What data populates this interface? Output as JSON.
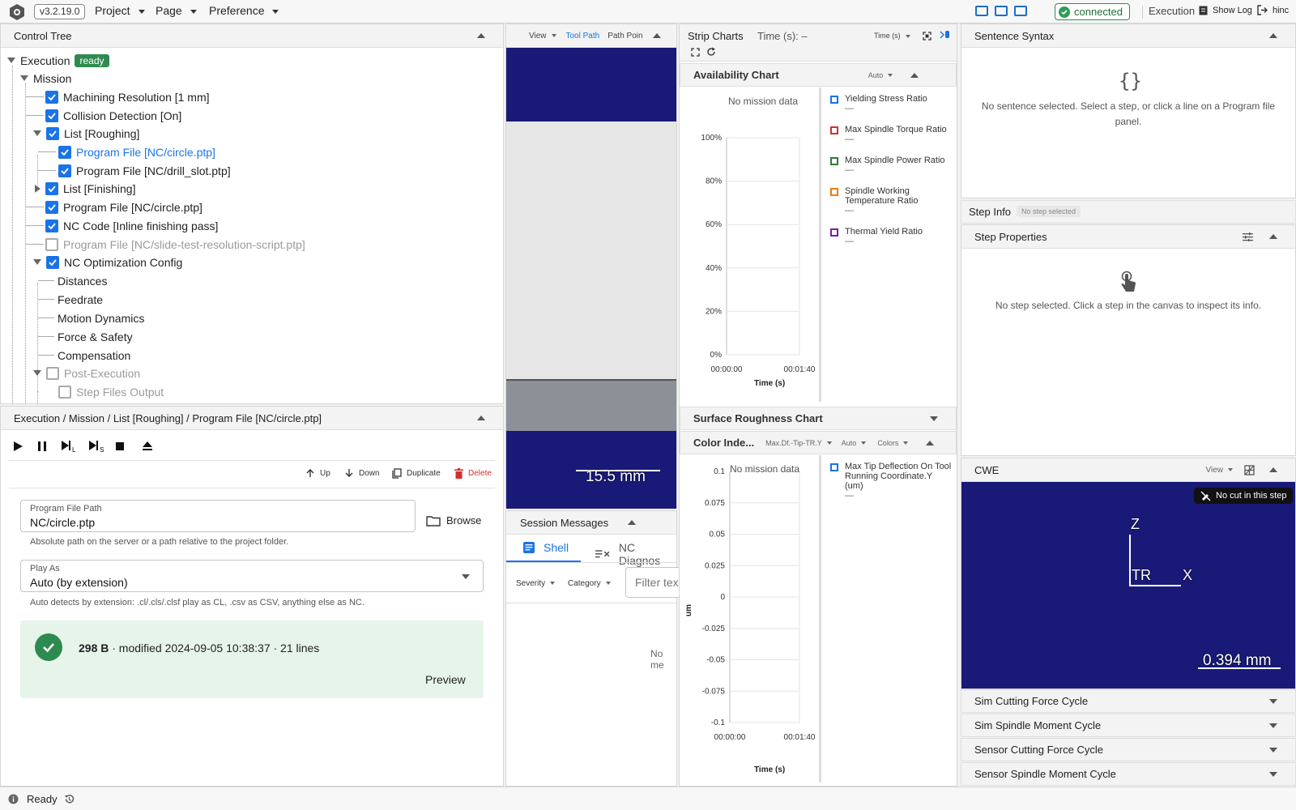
{
  "topbar": {
    "version": "v3.2.19.0",
    "menus": [
      "Project",
      "Page",
      "Preference"
    ],
    "connection": "connected",
    "mode": "Execution",
    "show_log": "Show Log",
    "user": "hinc"
  },
  "control_tree": {
    "title": "Control Tree",
    "execution_label": "Execution",
    "execution_badge": "ready",
    "mission_label": "Mission",
    "items": [
      "Machining Resolution [1 mm]",
      "Collision Detection [On]",
      "List [Roughing]",
      "Program File [NC/circle.ptp]",
      "Program File [NC/drill_slot.ptp]",
      "List [Finishing]",
      "Program File [NC/circle.ptp]",
      "NC Code [Inline finishing pass]",
      "Program File [NC/slide-test-resolution-script.ptp]",
      "NC Optimization Config",
      "Distances",
      "Feedrate",
      "Motion Dynamics",
      "Force & Safety",
      "Compensation",
      "Post-Execution",
      "Step Files Output"
    ]
  },
  "detail": {
    "breadcrumb": "Execution / Mission / List [Roughing] / Program File [NC/circle.ptp]",
    "actions": {
      "up": "Up",
      "down": "Down",
      "duplicate": "Duplicate",
      "delete": "Delete"
    },
    "path_label": "Program File Path",
    "path_value": "NC/circle.ptp",
    "browse": "Browse",
    "path_helper": "Absolute path on the server or a path relative to the project folder.",
    "play_as_label": "Play As",
    "play_as_value": "Auto (by extension)",
    "play_as_helper": "Auto detects by extension: .cl/.cls/.clsf play as CL, .csv as CSV, anything else as NC.",
    "file_size": "298 B",
    "file_meta": "· modified 2024-09-05 10:38:37 · 21 lines",
    "preview": "Preview"
  },
  "viewport": {
    "view": "View",
    "tool_path": "Tool Path",
    "path_point": "Path Poin",
    "scale": "15.5 mm"
  },
  "session": {
    "title": "Session Messages",
    "tab_shell": "Shell",
    "tab_diag": "NC Diagnos",
    "severity": "Severity",
    "category": "Category",
    "filter_placeholder": "Filter tex",
    "empty": "No me"
  },
  "strip": {
    "title": "Strip Charts",
    "time_label": "Time (s): –",
    "time_select": "Time (s)"
  },
  "availability": {
    "title": "Availability Chart",
    "auto": "Auto",
    "no_data": "No mission data",
    "xlabel": "Time (s)"
  },
  "surface": {
    "title": "Surface Roughness Chart"
  },
  "color_index": {
    "title": "Color Inde...",
    "metric": "Max.Df.-Tip-TR.Y",
    "auto": "Auto",
    "colors": "Colors",
    "no_data": "No mission data",
    "ylabel": "um",
    "xlabel": "Time (s)"
  },
  "chart_data": [
    {
      "type": "line",
      "title": "Availability Chart",
      "xlabel": "Time (s)",
      "ylabel": "",
      "x_ticks": [
        "00:00:00",
        "00:01:40"
      ],
      "y_ticks": [
        "100%",
        "80%",
        "60%",
        "40%",
        "20%",
        "0%"
      ],
      "ylim": [
        0,
        100
      ],
      "series": [
        {
          "name": "Yielding Stress Ratio",
          "value": "—",
          "color": "#1a73e8",
          "values": []
        },
        {
          "name": "Max Spindle Torque Ratio",
          "value": "—",
          "color": "#d32f2f",
          "values": []
        },
        {
          "name": "Max Spindle Power Ratio",
          "value": "—",
          "color": "#2e7d32",
          "values": []
        },
        {
          "name": "Spindle Working Temperature Ratio",
          "value": "—",
          "color": "#f57c00",
          "values": []
        },
        {
          "name": "Thermal Yield Ratio",
          "value": "—",
          "color": "#7b1fa2",
          "values": []
        }
      ]
    },
    {
      "type": "line",
      "title": "Color Inde...",
      "xlabel": "Time (s)",
      "ylabel": "um",
      "x_ticks": [
        "00:00:00",
        "00:01:40"
      ],
      "y_ticks": [
        "0.1",
        "0.075",
        "0.05",
        "0.025",
        "0",
        "-0.025",
        "-0.05",
        "-0.075",
        "-0.1"
      ],
      "ylim": [
        -0.1,
        0.1
      ],
      "series": [
        {
          "name": "Max Tip Deflection On Tool Running Coordinate.Y (um)",
          "value": "—",
          "color": "#1a73e8",
          "values": []
        }
      ]
    }
  ],
  "sentence": {
    "title": "Sentence Syntax",
    "empty": "No sentence selected. Select a step, or click a line on a Program file panel."
  },
  "step_info": {
    "title": "Step Info",
    "badge": "No step selected"
  },
  "step_props": {
    "title": "Step Properties",
    "empty": "No step selected. Click a step in the canvas to inspect its info."
  },
  "cwe": {
    "title": "CWE",
    "view": "View",
    "no_cut": "No cut in this step",
    "z": "Z",
    "x": "X",
    "tr": "TR",
    "scale": "0.394 mm"
  },
  "accordions": [
    "Sim Cutting Force Cycle",
    "Sim Spindle Moment Cycle",
    "Sensor Cutting Force Cycle",
    "Sensor Spindle Moment Cycle"
  ],
  "status": {
    "text": "Ready"
  }
}
